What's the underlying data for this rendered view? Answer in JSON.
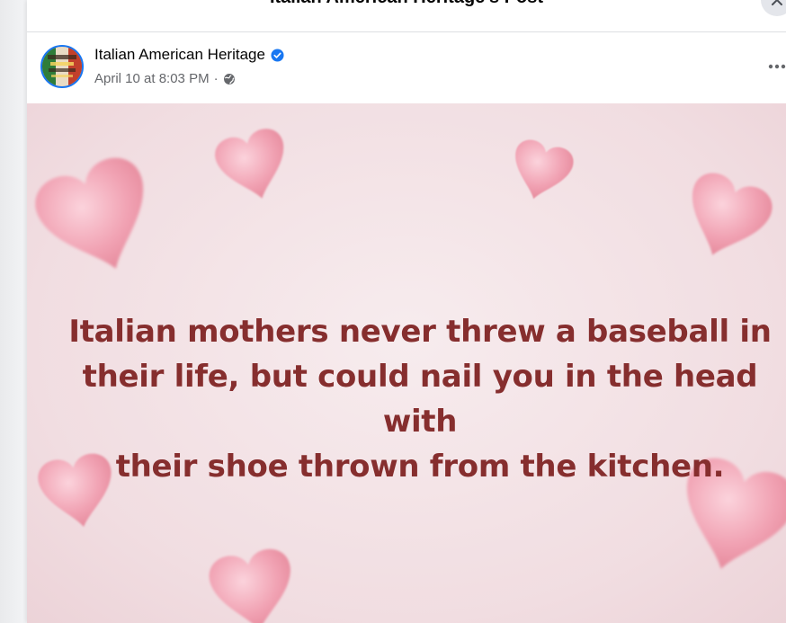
{
  "dialog": {
    "title": "Italian American Heritage's Post",
    "close_icon": "close-icon"
  },
  "post": {
    "author": "Italian American Heritage",
    "verified_icon": "verified-badge-icon",
    "timestamp": "April 10 at 8:03 PM",
    "separator": "·",
    "privacy_icon": "globe-icon",
    "more_icon": "more-options-icon"
  },
  "image": {
    "caption_lines": [
      "Italian mothers never threw a baseball in",
      "their life, but could nail you in the head with",
      "their shoe thrown from the kitchen."
    ],
    "caption_color": "#862e2e",
    "background_color": "#f3e2e5",
    "heart_color": "#f2a3b2"
  },
  "colors": {
    "avatar_ring": "#1877f2",
    "meta_text": "#65676b"
  }
}
